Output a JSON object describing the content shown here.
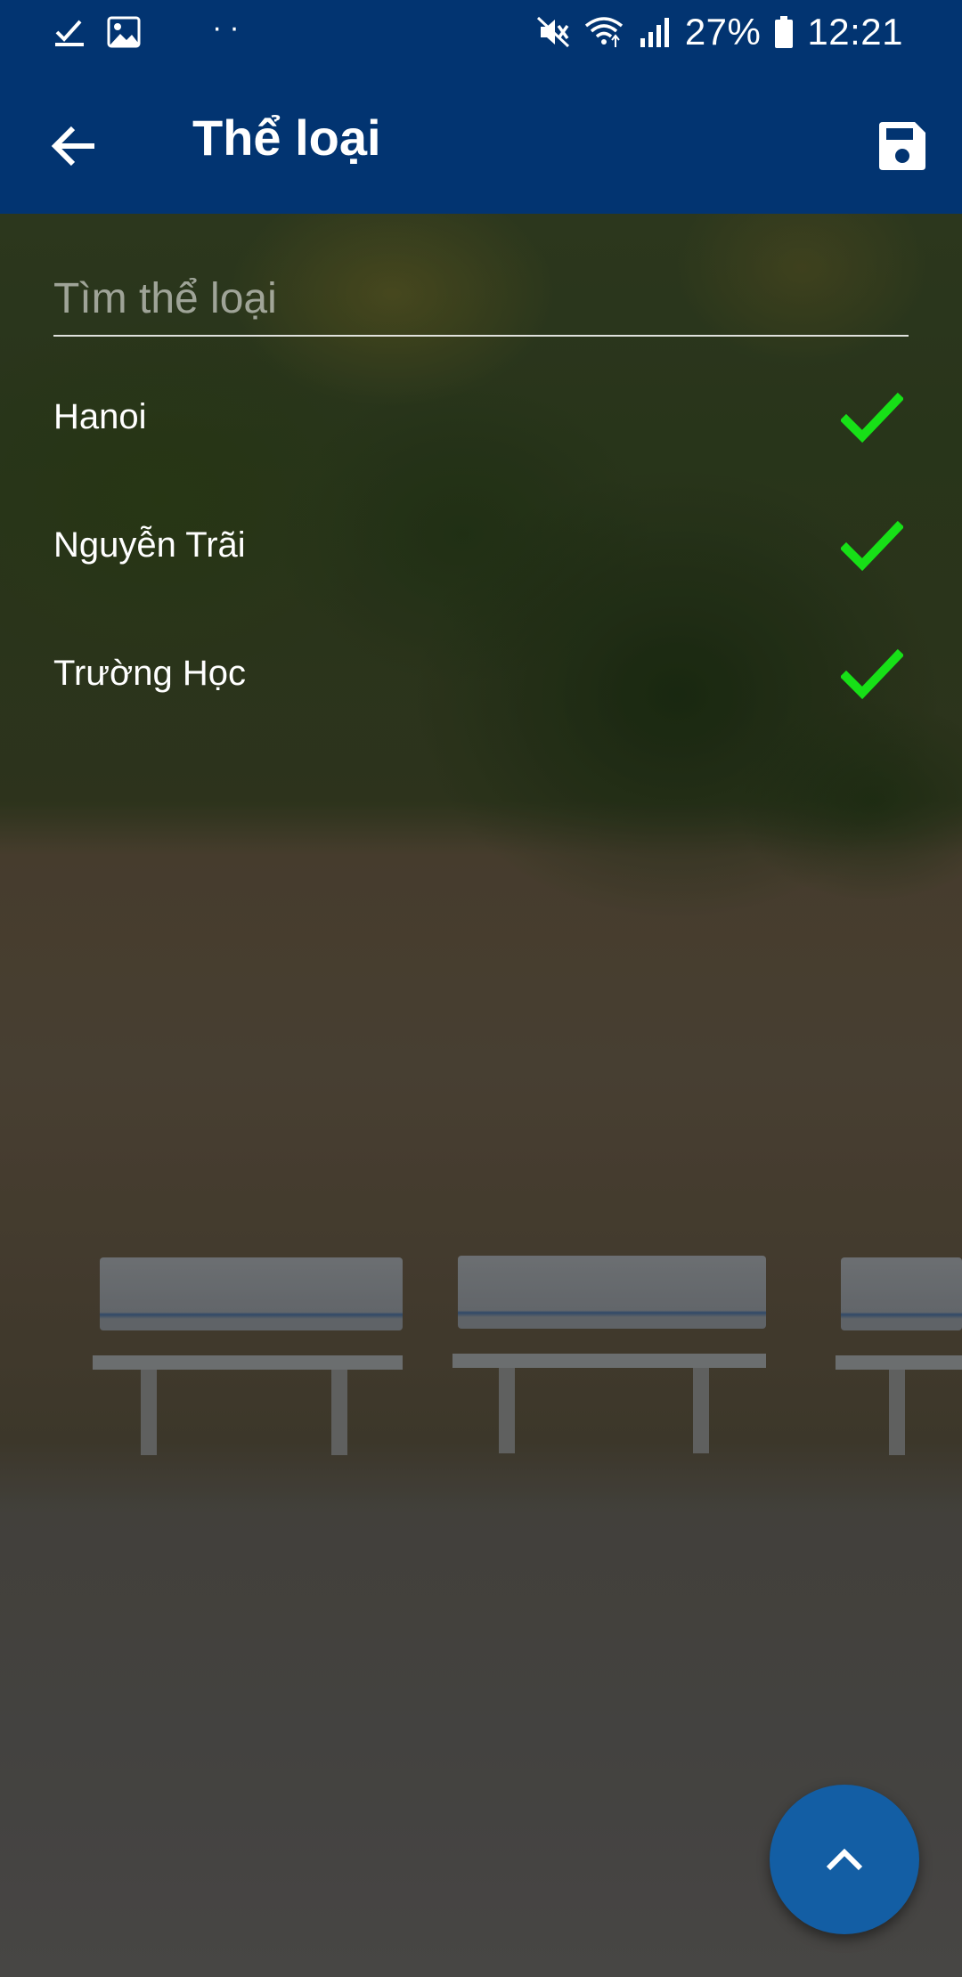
{
  "status_bar": {
    "battery_percent_text": "27%",
    "time": "12:21",
    "icons": [
      "check-notification-icon",
      "image-notification-icon",
      "more-dots-icon",
      "mute-icon",
      "wifi-icon",
      "signal-icon",
      "battery-icon"
    ],
    "dots": "··"
  },
  "app_bar": {
    "title": "Thể loại",
    "back_icon": "arrow-left-icon",
    "save_icon": "floppy-disk-icon",
    "background_color": "#023471"
  },
  "search": {
    "placeholder": "Tìm thể loại",
    "value": ""
  },
  "categories": [
    {
      "label": "Hanoi",
      "selected": true
    },
    {
      "label": "Nguyễn Trãi",
      "selected": true
    },
    {
      "label": "Trường Học",
      "selected": true
    }
  ],
  "fab": {
    "icon": "chevron-up-icon",
    "color": "#135ea4"
  },
  "colors": {
    "check_green": "#17e017",
    "text": "#ffffff"
  }
}
